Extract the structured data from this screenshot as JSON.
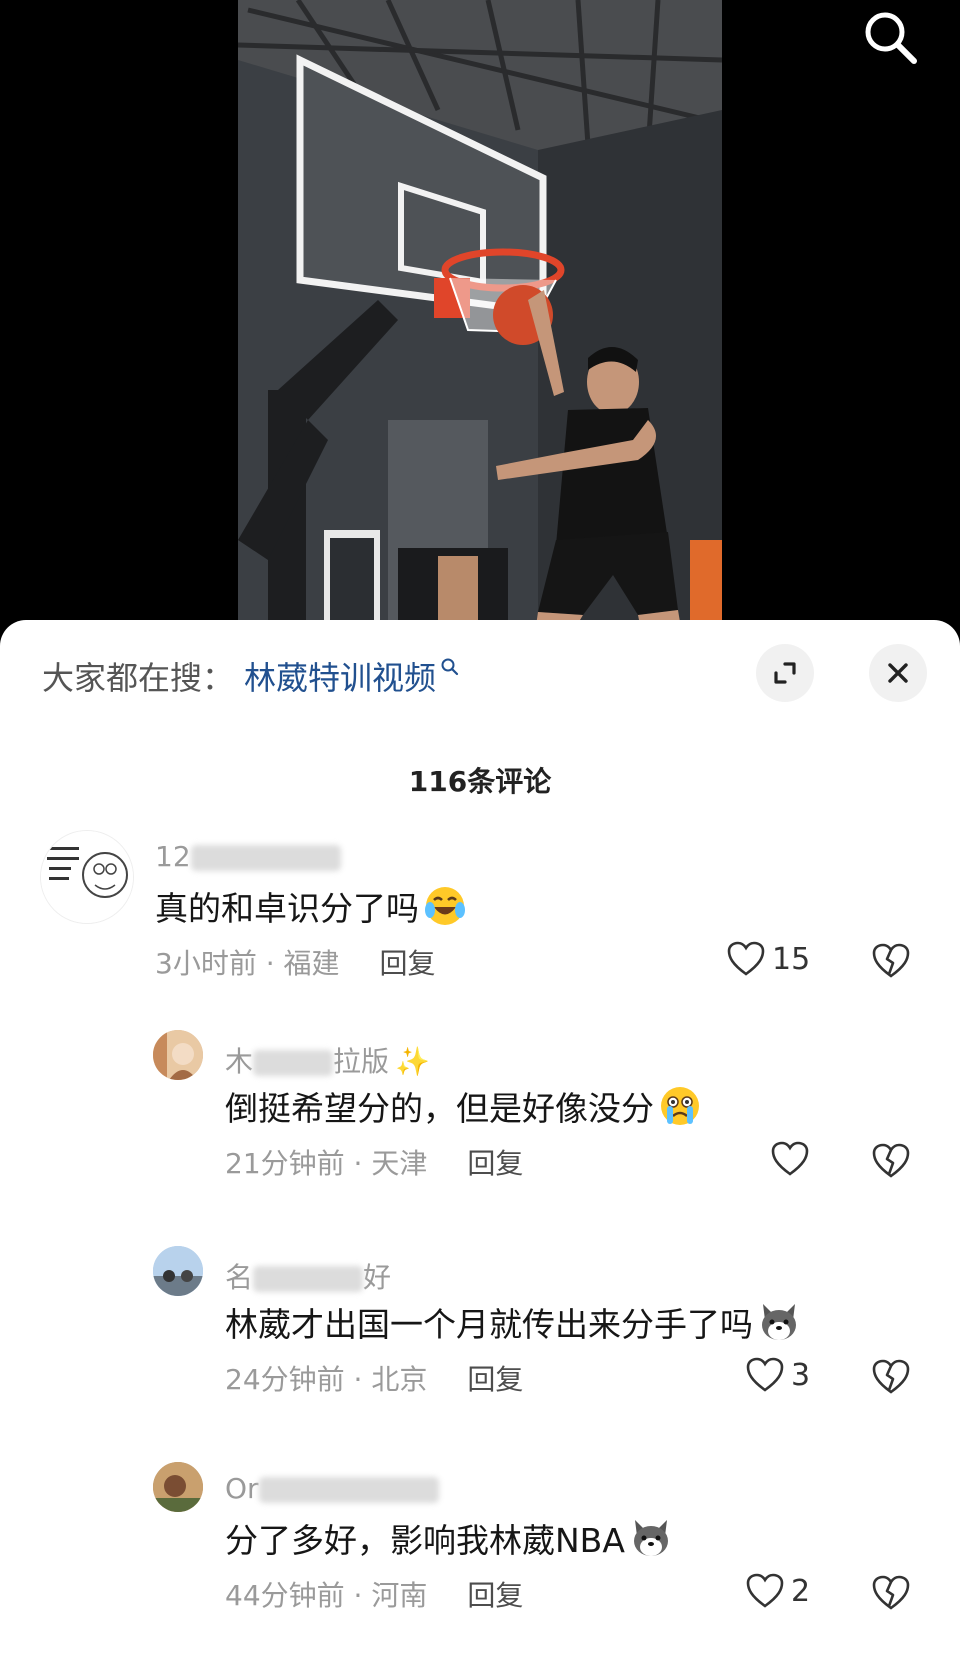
{
  "video": {
    "description_icon": "search-icon"
  },
  "hot_search": {
    "label": "大家都在搜：",
    "query": "林葳特训视频"
  },
  "comment_count_title": "116条评论",
  "comments": [
    {
      "username_visible": "12",
      "text": "真的和卓识分了吗",
      "emoji": "laughing-crying-emoji",
      "time": "3小时前",
      "location": "福建",
      "reply": "回复",
      "likes": "15"
    },
    {
      "username_visible": "木",
      "username_tail": "拉版",
      "text": "倒挺希望分的，但是好像没分",
      "emoji": "crying-emoji",
      "time": "21分钟前",
      "location": "天津",
      "reply": "回复",
      "likes": ""
    },
    {
      "username_visible": "名",
      "username_tail": "好",
      "text": "林葳才出国一个月就传出来分手了吗",
      "emoji": "dog-emoji",
      "time": "24分钟前",
      "location": "北京",
      "reply": "回复",
      "likes": "3"
    },
    {
      "username_visible": "Or",
      "text": "分了多好，影响我林葳NBA",
      "emoji": "dog-emoji",
      "time": "44分钟前",
      "location": "河南",
      "reply": "回复",
      "likes": "2"
    }
  ],
  "meta_separator": " · ",
  "colors": {
    "link": "#21508f",
    "muted": "#9a9a9a",
    "text": "#161616"
  }
}
